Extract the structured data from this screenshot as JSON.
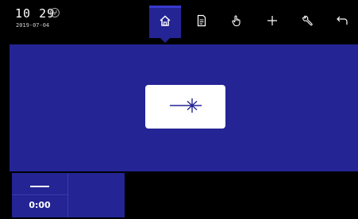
{
  "status": {
    "time": "10 29",
    "date": "2019-07-04",
    "status_icon": "power-plug-icon"
  },
  "nav": {
    "items": [
      {
        "name": "home",
        "icon": "home-icon",
        "active": true
      },
      {
        "name": "document",
        "icon": "document-icon",
        "active": false
      },
      {
        "name": "touch",
        "icon": "hand-pointer-icon",
        "active": false
      },
      {
        "name": "add",
        "icon": "plus-icon",
        "active": false
      },
      {
        "name": "tools",
        "icon": "wrench-icon",
        "active": false
      },
      {
        "name": "back",
        "icon": "return-arrow-icon",
        "active": false
      }
    ]
  },
  "main": {
    "center_button_icon": "cut-asterisk-icon"
  },
  "bottom": {
    "value_placeholder": "—",
    "timer": "0:00"
  },
  "colors": {
    "primary": "#242495",
    "background": "#000000",
    "button": "#ffffff",
    "accent": "#3a3ad0"
  }
}
